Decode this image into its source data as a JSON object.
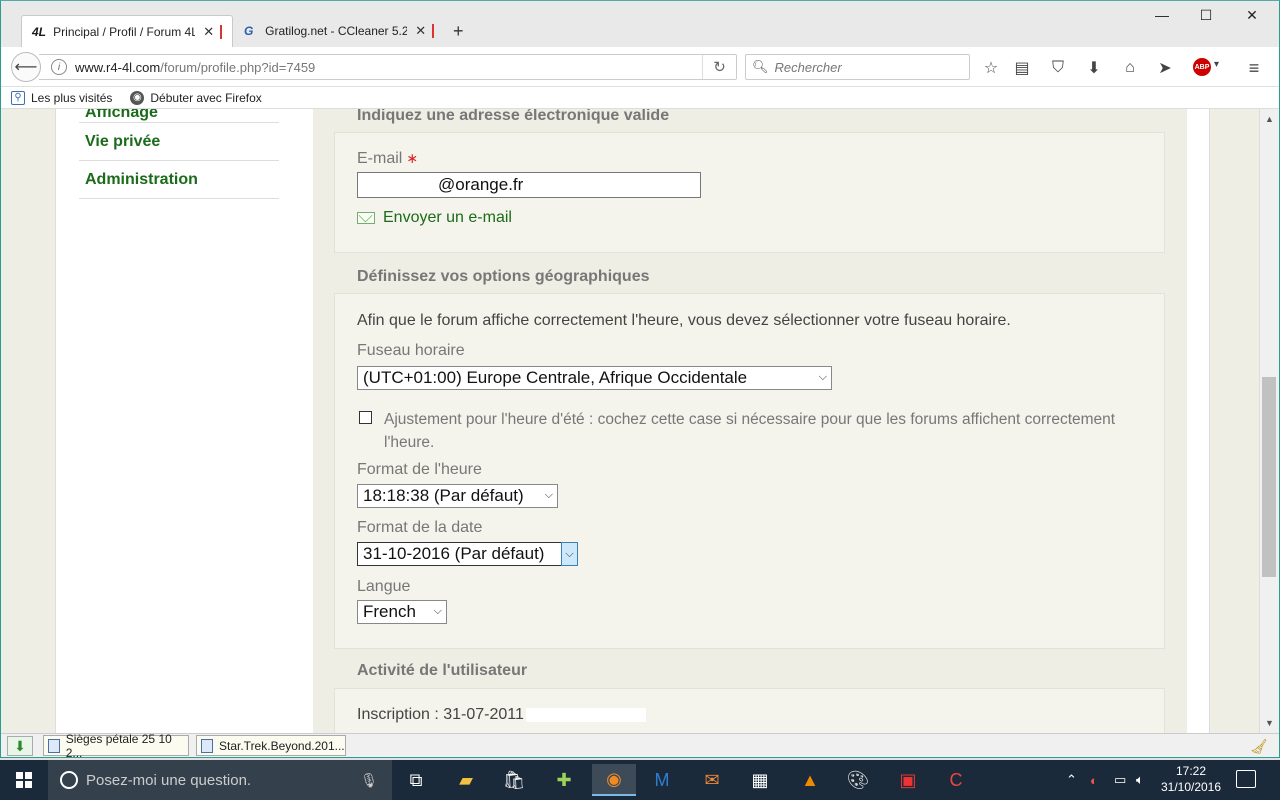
{
  "browser": {
    "tabs": [
      {
        "label": "Principal / Profil / Forum 4L",
        "favicon": "4L",
        "active": true
      },
      {
        "label": "Gratilog.net - CCleaner 5.2...",
        "favicon": "G",
        "active": false
      }
    ],
    "url_host": "www.r4-4l.com",
    "url_path": "/forum/profile.php?id=7459",
    "search_placeholder": "Rechercher",
    "bookmarks": [
      "Les plus visités",
      "Débuter avec Firefox"
    ],
    "toolbar_icons": [
      "bookmark-star-icon",
      "reading-list-icon",
      "pocket-icon",
      "download-icon",
      "home-icon",
      "send-icon",
      "adblock-icon",
      "menu-icon"
    ],
    "abp_label": "ABP"
  },
  "sidebar": {
    "items": [
      "Affichage",
      "Vie privée",
      "Administration"
    ]
  },
  "email_section": {
    "title": "Indiquez une adresse électronique valide",
    "label": "E-mail",
    "required_mark": "∗",
    "value": "@orange.fr",
    "send_link": "Envoyer un e-mail"
  },
  "geo_section": {
    "title": "Définissez vos options géographiques",
    "intro": "Afin que le forum affiche correctement l'heure, vous devez sélectionner votre fuseau horaire.",
    "timezone_label": "Fuseau horaire",
    "timezone_value": "(UTC+01:00) Europe Centrale, Afrique Occidentale",
    "dst_label_line1": "Ajustement pour l'heure d'été : cochez cette case si nécessaire pour que les forums affichent correctement",
    "dst_label_line2": "l'heure.",
    "dst_checked": false,
    "time_format_label": "Format de l'heure",
    "time_format_value": "18:18:38 (Par défaut)",
    "date_format_label": "Format de la date",
    "date_format_value": "31-10-2016 (Par défaut)",
    "language_label": "Langue",
    "language_value": "French"
  },
  "activity_section": {
    "title": "Activité de l'utilisateur",
    "registration": "Inscription : 31-07-2011"
  },
  "downloads": [
    "Sièges pétale 25 10 2...",
    "Star.Trek.Beyond.201..."
  ],
  "taskbar": {
    "search_placeholder": "Posez-moi une question.",
    "time": "17:22",
    "date": "31/10/2016"
  }
}
